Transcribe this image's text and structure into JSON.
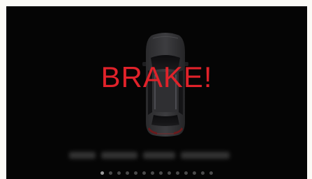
{
  "screen": {
    "warning_text": "BRAKE!",
    "warning_color": "#e0222a",
    "background_color": "#050505",
    "vehicle_icon": "car-top-view-icon"
  },
  "pagination": {
    "total": 14,
    "active_index": 0
  }
}
